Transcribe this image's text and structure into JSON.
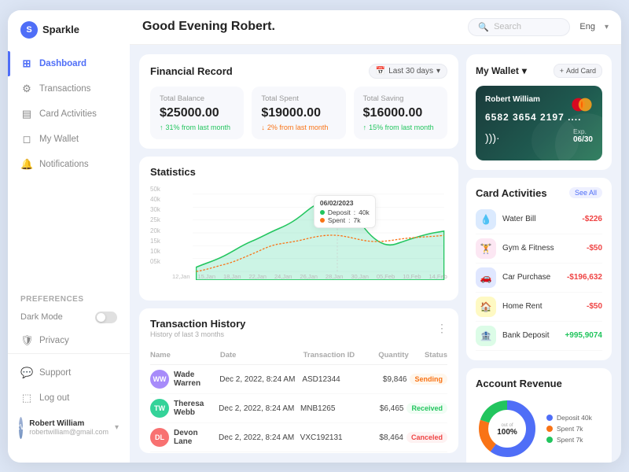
{
  "app": {
    "name": "Sparkle",
    "greeting": "Good Evening Robert.",
    "search_placeholder": "Search",
    "language": "Eng"
  },
  "sidebar": {
    "nav_items": [
      {
        "label": "Dashboard",
        "icon": "⊞",
        "active": true
      },
      {
        "label": "Transactions",
        "icon": "⚙"
      },
      {
        "label": "Card Activities",
        "icon": "▤"
      },
      {
        "label": "My Wallet",
        "icon": "◻"
      },
      {
        "label": "Notifications",
        "icon": "🔔"
      }
    ],
    "preferences_label": "Preferences",
    "dark_mode_label": "Dark Mode",
    "privacy_label": "Privacy",
    "bottom_nav": [
      {
        "label": "Support",
        "icon": "💬"
      },
      {
        "label": "Log out",
        "icon": "⬚"
      }
    ],
    "user": {
      "name": "Robert William",
      "email": "robertwilliam@gmail.com",
      "initials": "RW"
    }
  },
  "financial_record": {
    "title": "Financial Record",
    "date_range": "Last 30 days",
    "cards": [
      {
        "label": "Total Balance",
        "value": "$25000.00",
        "change": "31% from last month",
        "direction": "up"
      },
      {
        "label": "Total Spent",
        "value": "$19000.00",
        "change": "2% from last month",
        "direction": "down"
      },
      {
        "label": "Total Saving",
        "value": "$16000.00",
        "change": "15% from last month",
        "direction": "up"
      }
    ]
  },
  "statistics": {
    "title": "Statistics",
    "x_labels": [
      "12,Jan",
      "15,Jan",
      "18,Jan",
      "22,Jan",
      "24,Jan",
      "26,Jan",
      "28,Jan",
      "30,Jan",
      "05,Feb",
      "10,Feb",
      "14,Feb"
    ],
    "y_labels": [
      "50k",
      "40k",
      "30k",
      "25k",
      "20k",
      "15k",
      "10k",
      "05k"
    ],
    "tooltip": {
      "date": "06/02/2023",
      "deposit_label": "Deposit",
      "deposit_value": "40k",
      "spent_label": "Spent",
      "spent_value": "7k"
    }
  },
  "transactions": {
    "title": "Transaction History",
    "subtitle": "History of last 3 months",
    "columns": [
      "Name",
      "Date",
      "Transaction ID",
      "Quantity",
      "Status"
    ],
    "rows": [
      {
        "name": "Wade Warren",
        "date": "Dec 2, 2022, 8:24 AM",
        "tid": "ASD12344",
        "qty": "$9,846",
        "status": "Sending",
        "status_class": "sending",
        "color": "#a78bfa"
      },
      {
        "name": "Theresa Webb",
        "date": "Dec 2, 2022, 8:24 AM",
        "tid": "MNB1265",
        "qty": "$6,465",
        "status": "Received",
        "status_class": "received",
        "color": "#34d399"
      },
      {
        "name": "Devon Lane",
        "date": "Dec 2, 2022, 8:24 AM",
        "tid": "VXC192131",
        "qty": "$8,464",
        "status": "Canceled",
        "status_class": "canceled",
        "color": "#f87171"
      }
    ]
  },
  "wallet": {
    "title": "My Wallet",
    "add_card_label": "Add Card",
    "card": {
      "name": "Robert William",
      "number": "6582 3654 2197 ....",
      "expiry_label": "Exp.",
      "expiry": "06/30"
    }
  },
  "card_activities": {
    "title": "Card Activities",
    "see_all": "See All",
    "items": [
      {
        "name": "Water Bill",
        "amount": "-$226",
        "type": "neg",
        "icon": "💧",
        "bg": "#dbeafe"
      },
      {
        "name": "Gym & Fitness",
        "amount": "-$50",
        "type": "neg",
        "icon": "🏋",
        "bg": "#fce7f3"
      },
      {
        "name": "Car Purchase",
        "amount": "-$196,632",
        "type": "neg",
        "icon": "🚗",
        "bg": "#e0e7ff"
      },
      {
        "name": "Home Rent",
        "amount": "-$50",
        "type": "neg",
        "icon": "🏠",
        "bg": "#fef9c3"
      },
      {
        "name": "Bank Deposit",
        "amount": "+995,9074",
        "type": "pos",
        "icon": "🏦",
        "bg": "#dcfce7"
      }
    ]
  },
  "account_revenue": {
    "title": "Account Revenue",
    "center_value": "100%",
    "center_label": "out of",
    "legend": [
      {
        "label": "Deposit  40k",
        "color": "#4f6ef7"
      },
      {
        "label": "Spent     7k",
        "color": "#f97316"
      },
      {
        "label": "Spent     7k",
        "color": "#22c55e"
      }
    ],
    "segments": [
      {
        "value": 60,
        "color": "#4f6ef7"
      },
      {
        "value": 20,
        "color": "#f97316"
      },
      {
        "value": 20,
        "color": "#22c55e"
      }
    ]
  }
}
